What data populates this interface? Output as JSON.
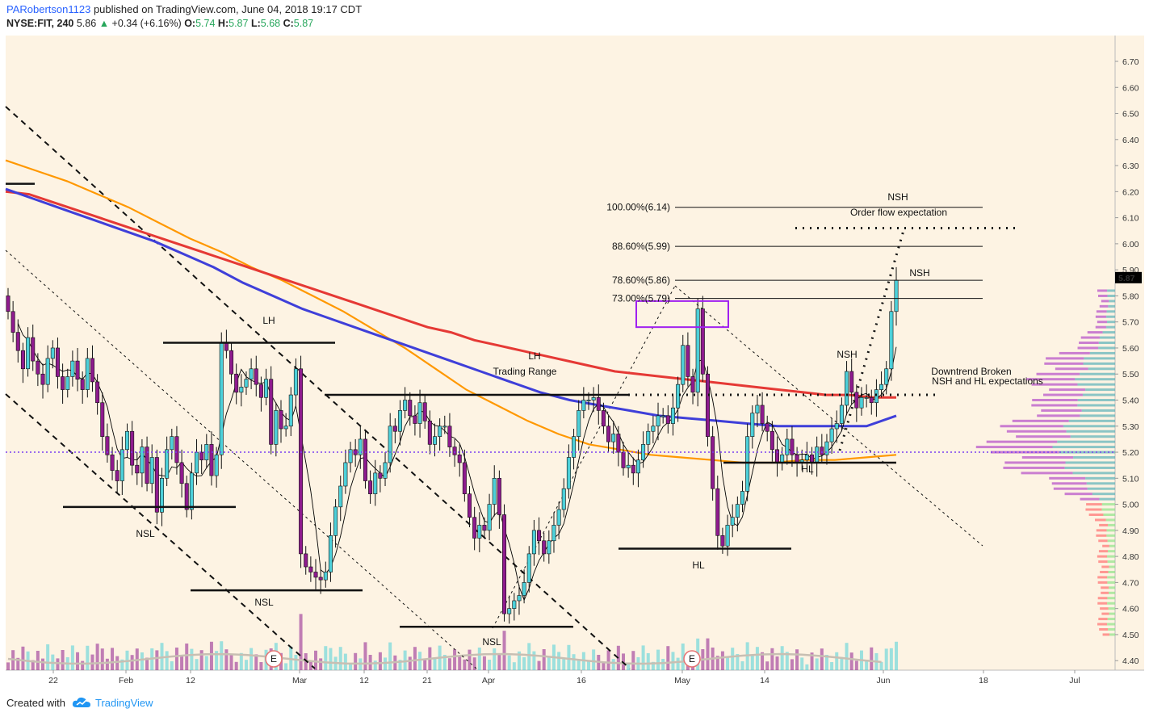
{
  "header": {
    "author": "PARobertson1123",
    "published_text": "published on TradingView.com, June 04, 2018 19:17 CDT",
    "symbol": "NYSE:FIT, 240",
    "last_price": "5.86",
    "change_arrow": "▲",
    "change": "+0.34 (+6.16%)",
    "o_label": "O:",
    "o_value": "5.74",
    "h_label": "H:",
    "h_value": "5.87",
    "l_label": "L:",
    "l_value": "5.68",
    "c_label": "C:",
    "c_value": "5.87"
  },
  "footer": {
    "created_with": "Created with",
    "brand": "TradingView"
  },
  "colors": {
    "background": "#fdf3e3",
    "bull_candle": "#4dd0d9",
    "bear_candle": "#8e1b8e",
    "ma_red": "#e53935",
    "ma_orange": "#ff9800",
    "ma_blue": "#3f3fd9",
    "ma_thin": "#000000",
    "price_badge": "#000000",
    "dotted_level": "#7b3ff2"
  },
  "chart_data": {
    "type": "candlestick",
    "y_axis": {
      "ticks": [
        "6.70",
        "6.60",
        "6.50",
        "6.40",
        "6.30",
        "6.20",
        "6.10",
        "6.00",
        "5.90",
        "5.80",
        "5.70",
        "5.60",
        "5.50",
        "5.40",
        "5.30",
        "5.20",
        "5.10",
        "5.00",
        "4.90",
        "4.80",
        "4.70",
        "4.60",
        "4.50",
        "4.40"
      ],
      "range": [
        4.37,
        6.77
      ],
      "current_price_label": "5.87"
    },
    "x_axis": {
      "ticks": [
        "22",
        "Feb",
        "12",
        "Mar",
        "12",
        "21",
        "Apr",
        "16",
        "May",
        "14",
        "Jun",
        "18",
        "Jul"
      ]
    },
    "annotations": [
      "LH",
      "LH",
      "Trading Range",
      "NSL",
      "NSL",
      "NSL",
      "HL",
      "HL",
      "NSH",
      "NSH",
      "NSH",
      "Order flow expectation",
      "Downtrend Broken",
      "NSH and HL expectations"
    ],
    "fib_levels": [
      {
        "label": "100.00%(6.14)",
        "price": 6.14
      },
      {
        "label": "88.60%(5.99)",
        "price": 5.99
      },
      {
        "label": "78.60%(5.86)",
        "price": 5.86
      },
      {
        "label": "73.00%(5.79)",
        "price": 5.79
      }
    ],
    "levels": [
      {
        "name": "resistance-lh",
        "price": 5.62
      },
      {
        "name": "range-top",
        "price": 5.42
      },
      {
        "name": "support-nsl-1",
        "price": 4.99
      },
      {
        "name": "support-nsl-2",
        "price": 4.67
      },
      {
        "name": "support-nsl-3",
        "price": 4.53
      },
      {
        "name": "support-hl-1",
        "price": 4.83
      },
      {
        "name": "support-hl-2",
        "price": 5.16
      },
      {
        "name": "dotted-breakout",
        "price": 5.42
      },
      {
        "name": "dotted-target",
        "price": 6.06
      },
      {
        "name": "dotted-poc",
        "price": 5.2
      }
    ],
    "earnings_markers": [
      "E",
      "E"
    ],
    "closes": [
      5.74,
      5.66,
      5.59,
      5.52,
      5.64,
      5.55,
      5.5,
      5.46,
      5.56,
      5.6,
      5.49,
      5.44,
      5.49,
      5.55,
      5.48,
      5.44,
      5.56,
      5.47,
      5.39,
      5.26,
      5.19,
      5.13,
      5.09,
      5.21,
      5.28,
      5.15,
      5.12,
      5.22,
      5.08,
      5.18,
      4.97,
      5.1,
      5.21,
      5.26,
      5.16,
      5.08,
      4.98,
      5.12,
      5.2,
      5.17,
      5.23,
      5.11,
      5.19,
      5.62,
      5.59,
      5.5,
      5.43,
      5.45,
      5.48,
      5.52,
      5.46,
      5.41,
      5.48,
      5.23,
      5.36,
      5.29,
      5.3,
      5.42,
      5.52,
      4.81,
      4.76,
      4.74,
      4.72,
      4.71,
      4.74,
      4.88,
      4.99,
      5.07,
      5.16,
      5.21,
      5.19,
      5.25,
      5.09,
      5.04,
      5.12,
      5.1,
      5.16,
      5.3,
      5.28,
      5.36,
      5.4,
      5.34,
      5.31,
      5.39,
      5.32,
      5.23,
      5.26,
      5.3,
      5.3,
      5.22,
      5.19,
      5.16,
      5.04,
      4.95,
      4.87,
      4.92,
      4.9,
      5.0,
      5.1,
      4.96,
      4.58,
      4.6,
      4.63,
      4.65,
      4.7,
      4.81,
      4.9,
      4.86,
      4.81,
      4.86,
      4.92,
      4.98,
      5.06,
      5.18,
      5.26,
      5.36,
      5.4,
      5.4,
      5.41,
      5.36,
      5.3,
      5.24,
      5.27,
      5.2,
      5.14,
      5.15,
      5.12,
      5.17,
      5.23,
      5.28,
      5.3,
      5.34,
      5.34,
      5.31,
      5.37,
      5.46,
      5.61,
      5.49,
      5.43,
      5.75,
      5.5,
      5.26,
      5.06,
      4.88,
      4.84,
      4.92,
      4.95,
      5.0,
      5.05,
      5.26,
      5.35,
      5.38,
      5.31,
      5.28,
      5.21,
      5.16,
      5.19,
      5.25,
      5.19,
      5.16,
      5.17,
      5.19,
      5.16,
      5.22,
      5.19,
      5.24,
      5.29,
      5.31,
      5.38,
      5.51,
      5.43,
      5.37,
      5.41,
      5.41,
      5.39,
      5.44,
      5.46,
      5.52,
      5.74,
      5.86
    ],
    "ma_red": [
      6.2,
      6.19,
      6.16,
      6.13,
      6.1,
      6.07,
      6.04,
      6.01,
      5.98,
      5.95,
      5.92,
      5.89,
      5.86,
      5.83,
      5.8,
      5.77,
      5.74,
      5.71,
      5.68,
      5.66,
      5.63,
      5.61,
      5.59,
      5.57,
      5.55,
      5.53,
      5.51,
      5.5,
      5.49,
      5.48,
      5.47,
      5.46,
      5.45,
      5.44,
      5.43,
      5.42,
      5.42,
      5.41,
      5.41
    ],
    "ma_orange": [
      6.32,
      6.28,
      6.24,
      6.19,
      6.14,
      6.08,
      6.02,
      5.97,
      5.91,
      5.86,
      5.8,
      5.74,
      5.67,
      5.6,
      5.52,
      5.44,
      5.38,
      5.32,
      5.27,
      5.23,
      5.21,
      5.19,
      5.18,
      5.17,
      5.16,
      5.16,
      5.17,
      5.17,
      5.18,
      5.19
    ],
    "ma_blue": [
      6.21,
      6.17,
      6.13,
      6.09,
      6.05,
      6.01,
      5.96,
      5.91,
      5.85,
      5.8,
      5.75,
      5.71,
      5.67,
      5.63,
      5.59,
      5.55,
      5.51,
      5.47,
      5.43,
      5.4,
      5.38,
      5.36,
      5.34,
      5.33,
      5.32,
      5.31,
      5.3,
      5.3,
      5.3,
      5.3,
      5.34
    ]
  }
}
